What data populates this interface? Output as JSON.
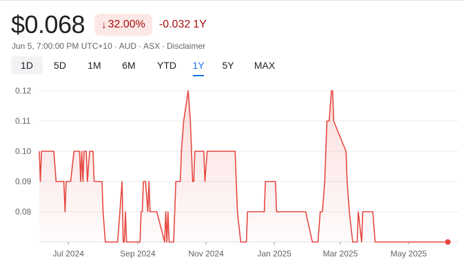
{
  "header": {
    "price": "$0.068",
    "change_arrow": "↓",
    "change_percent": "32.00%",
    "change_abs": "-0.032",
    "change_period": "1Y",
    "meta_time": "Jun 5, 7:00:00 PM UTC+10",
    "meta_currency": "AUD",
    "meta_exchange": "ASX",
    "meta_disclaimer": "Disclaimer",
    "meta_separator": "·"
  },
  "tabs": [
    {
      "label": "1D"
    },
    {
      "label": "5D"
    },
    {
      "label": "1M"
    },
    {
      "label": "6M"
    },
    {
      "label": "YTD"
    },
    {
      "label": "1Y"
    },
    {
      "label": "5Y"
    },
    {
      "label": "MAX"
    }
  ],
  "colors": {
    "line": "#e5473f",
    "negative": "#a50e0e",
    "badge_bg": "#fce8e6",
    "active_tab": "#1a73e8"
  },
  "chart_data": {
    "type": "area",
    "title": "",
    "xlabel": "",
    "ylabel": "",
    "ylim": [
      0.07,
      0.12
    ],
    "yticks": [
      "0.12",
      "0.11",
      "0.10",
      "0.09",
      "0.08"
    ],
    "ytick_values": [
      0.12,
      0.11,
      0.1,
      0.09,
      0.08
    ],
    "xlim": [
      "2024-06-05",
      "2025-06-05"
    ],
    "xticks": [
      {
        "label": "Jul 2024",
        "date": "2024-07-01"
      },
      {
        "label": "Sep 2024",
        "date": "2024-09-01"
      },
      {
        "label": "Nov 2024",
        "date": "2024-11-01"
      },
      {
        "label": "Jan 2025",
        "date": "2025-01-01"
      },
      {
        "label": "Mar 2025",
        "date": "2025-03-01"
      },
      {
        "label": "May 2025",
        "date": "2025-05-01"
      }
    ],
    "grid": true,
    "series": [
      {
        "x": [
          "2024-06-05",
          "2024-06-06",
          "2024-06-07",
          "2024-06-09",
          "2024-06-18",
          "2024-06-20",
          "2024-06-27",
          "2024-06-28",
          "2024-06-29",
          "2024-07-01",
          "2024-07-03",
          "2024-07-06",
          "2024-07-11",
          "2024-07-12",
          "2024-07-13",
          "2024-07-14",
          "2024-07-15",
          "2024-07-17",
          "2024-07-18",
          "2024-07-20",
          "2024-07-23",
          "2024-07-24",
          "2024-07-25",
          "2024-07-26",
          "2024-07-27",
          "2024-07-28",
          "2024-07-29",
          "2024-07-31",
          "2024-08-01",
          "2024-08-03",
          "2024-08-14",
          "2024-08-16",
          "2024-08-18",
          "2024-08-19",
          "2024-08-20",
          "2024-08-21",
          "2024-08-22",
          "2024-08-23",
          "2024-08-24",
          "2024-08-25",
          "2024-08-26",
          "2024-08-27",
          "2024-08-28",
          "2024-08-29",
          "2024-09-03",
          "2024-09-04",
          "2024-09-05",
          "2024-09-06",
          "2024-09-08",
          "2024-09-10",
          "2024-09-11",
          "2024-09-12",
          "2024-09-14",
          "2024-09-15",
          "2024-09-16",
          "2024-09-18",
          "2024-09-25",
          "2024-09-26",
          "2024-09-27",
          "2024-09-28",
          "2024-09-29",
          "2024-09-30",
          "2024-10-01",
          "2024-10-02",
          "2024-10-03",
          "2024-10-04",
          "2024-10-05",
          "2024-10-06",
          "2024-10-07",
          "2024-10-09",
          "2024-10-10",
          "2024-10-12",
          "2024-10-16",
          "2024-10-18",
          "2024-10-19",
          "2024-10-20",
          "2024-10-21",
          "2024-10-22",
          "2024-10-23",
          "2024-10-25",
          "2024-10-26",
          "2024-10-27",
          "2024-10-28",
          "2024-10-29",
          "2024-10-30",
          "2024-10-31",
          "2024-11-02",
          "2024-11-04",
          "2024-11-06",
          "2024-11-07",
          "2024-11-09",
          "2024-11-12",
          "2024-11-13",
          "2024-11-14",
          "2024-11-15",
          "2024-11-16",
          "2024-11-17",
          "2024-11-25",
          "2024-11-27",
          "2024-11-28",
          "2024-11-29",
          "2024-12-02",
          "2024-12-07",
          "2024-12-08",
          "2024-12-09",
          "2024-12-11",
          "2024-12-12",
          "2024-12-21",
          "2024-12-23",
          "2024-12-24",
          "2025-01-01",
          "2025-01-02",
          "2025-01-03",
          "2025-01-04",
          "2025-01-06",
          "2025-01-07",
          "2025-01-21",
          "2025-01-22",
          "2025-01-23",
          "2025-01-25",
          "2025-01-27",
          "2025-01-29",
          "2025-02-04",
          "2025-02-05",
          "2025-02-07",
          "2025-02-09",
          "2025-02-11",
          "2025-02-13",
          "2025-02-15",
          "2025-02-17",
          "2025-02-19",
          "2025-02-21",
          "2025-02-22",
          "2025-02-23",
          "2025-03-06",
          "2025-03-07",
          "2025-03-09",
          "2025-03-12",
          "2025-03-13",
          "2025-03-15",
          "2025-03-16",
          "2025-03-17",
          "2025-03-20",
          "2025-03-21",
          "2025-03-23",
          "2025-03-24",
          "2025-03-30",
          "2025-04-01",
          "2025-06-05"
        ],
        "y": [
          0.1,
          0.09,
          0.1,
          0.1,
          0.1,
          0.09,
          0.09,
          0.08,
          0.09,
          0.09,
          0.09,
          0.1,
          0.1,
          0.09,
          0.1,
          0.09,
          0.1,
          0.1,
          0.09,
          0.1,
          0.1,
          0.09,
          0.09,
          0.09,
          0.09,
          0.09,
          0.09,
          0.09,
          0.08,
          0.07,
          0.07,
          0.08,
          0.09,
          0.07,
          0.07,
          0.08,
          0.07,
          0.07,
          0.07,
          0.07,
          0.07,
          0.07,
          0.07,
          0.07,
          0.07,
          0.08,
          0.08,
          0.09,
          0.09,
          0.08,
          0.09,
          0.08,
          0.08,
          0.08,
          0.08,
          0.08,
          0.07,
          0.08,
          0.07,
          0.08,
          0.07,
          0.07,
          0.07,
          0.07,
          0.07,
          0.08,
          0.09,
          0.09,
          0.09,
          0.09,
          0.1,
          0.11,
          0.12,
          0.11,
          0.1,
          0.09,
          0.09,
          0.1,
          0.1,
          0.1,
          0.1,
          0.1,
          0.1,
          0.1,
          0.1,
          0.09,
          0.1,
          0.1,
          0.1,
          0.1,
          0.1,
          0.1,
          0.1,
          0.1,
          0.1,
          0.1,
          0.1,
          0.1,
          0.1,
          0.09,
          0.08,
          0.07,
          0.07,
          0.08,
          0.08,
          0.08,
          0.08,
          0.08,
          0.08,
          0.09,
          0.09,
          0.09,
          0.08,
          0.08,
          0.08,
          0.08,
          0.08,
          0.08,
          0.08,
          0.08,
          0.08,
          0.08,
          0.07,
          0.07,
          0.07,
          0.07,
          0.08,
          0.08,
          0.09,
          0.11,
          0.11,
          0.12,
          0.12,
          0.11,
          0.1,
          0.09,
          0.08,
          0.07,
          0.07,
          0.07,
          0.07,
          0.08,
          0.07,
          0.08,
          0.08,
          0.08,
          0.08,
          0.07,
          0.07
        ]
      }
    ]
  }
}
